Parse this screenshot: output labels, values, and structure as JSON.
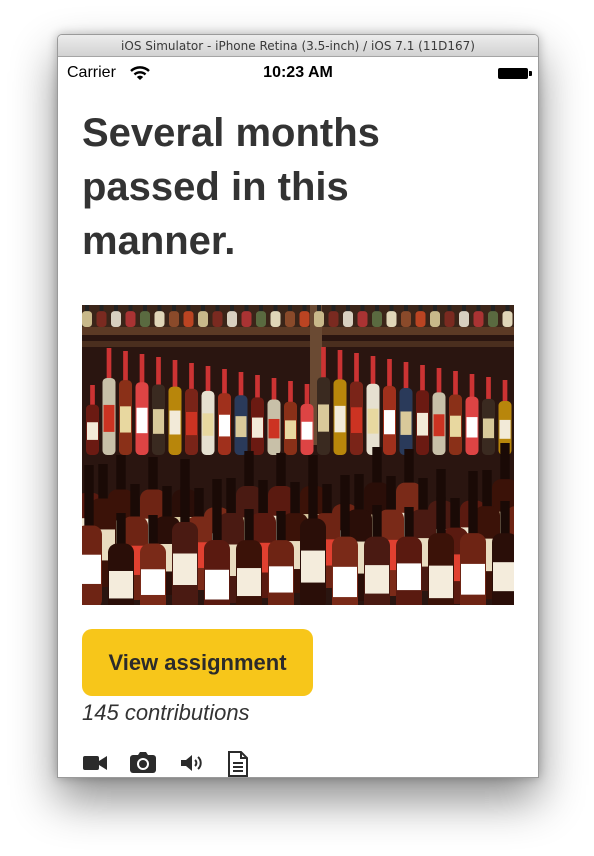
{
  "window": {
    "title": "iOS Simulator - iPhone Retina (3.5-inch) / iOS 7.1 (11D167)"
  },
  "statusbar": {
    "carrier": "Carrier",
    "time": "10:23 AM",
    "icons": [
      "wifi-icon",
      "battery-icon"
    ]
  },
  "content": {
    "headline": "Several months passed in this manner.",
    "photo": {
      "subject": "bottles on shelves"
    },
    "view_button_label": "View assignment",
    "contributions": "145 contributions",
    "media_icons": [
      "video-camera-icon",
      "photo-camera-icon",
      "speaker-icon",
      "document-icon"
    ]
  },
  "colors": {
    "button": "#f7c61a",
    "text": "#333333"
  }
}
